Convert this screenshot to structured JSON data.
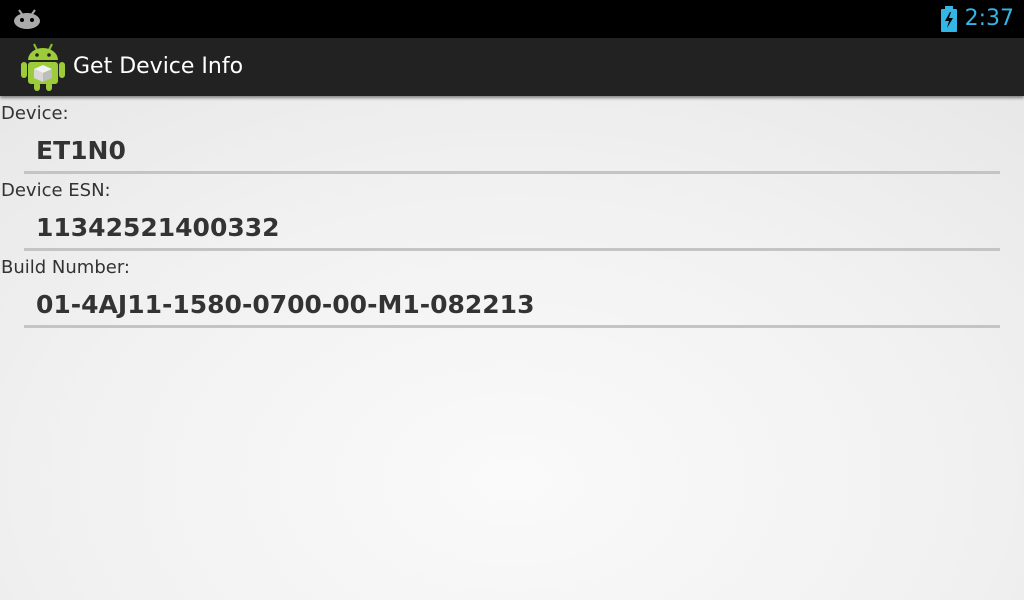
{
  "status_bar": {
    "time": "2:37",
    "icons": [
      "android-robot-icon",
      "battery-charging-icon"
    ],
    "time_color": "#33b5e5"
  },
  "action_bar": {
    "title": "Get Device Info",
    "icon": "android-app-icon"
  },
  "fields": [
    {
      "label": "Device:",
      "value": "ET1N0"
    },
    {
      "label": "Device ESN:",
      "value": "11342521400332"
    },
    {
      "label": "Build Number:",
      "value": "01-4AJ11-1580-0700-00-M1-082213"
    }
  ]
}
